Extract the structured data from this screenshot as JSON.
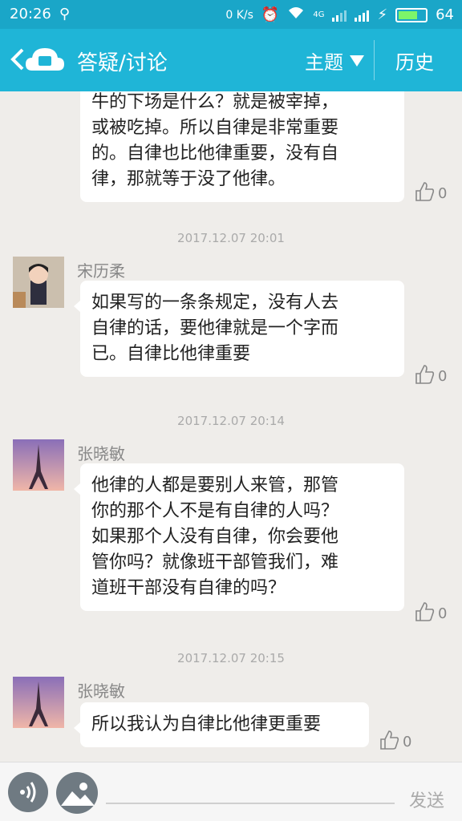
{
  "status": {
    "time": "20:26",
    "speed": "0 K/s",
    "network": "4G",
    "battery": "64",
    "battery_level": 0.64
  },
  "app": {
    "title": "答疑/讨论",
    "topic_label": "主题",
    "history_label": "历史"
  },
  "messages": [
    {
      "lines": [
        "牛的下场是什么？就是被宰掉，",
        "或被吃掉。所以自律是非常重要",
        "的。自律也比他律重要，没有自",
        "律，那就等于没了他律。"
      ],
      "likes": "0"
    },
    {
      "timestamp": "2017.12.07 20:01",
      "author": "宋历柔",
      "lines": [
        "如果写的一条条规定，没有人去",
        "自律的话，要他律就是一个字而",
        "已。自律比他律重要"
      ],
      "likes": "0"
    },
    {
      "timestamp": "2017.12.07 20:14",
      "author": "张晓敏",
      "lines": [
        "他律的人都是要别人来管，那管",
        "你的那个人不是有自律的人吗？",
        "如果那个人没有自律，你会要他",
        "管你吗？就像班干部管我们，难",
        "道班干部没有自律的吗？"
      ],
      "likes": "0"
    },
    {
      "timestamp": "2017.12.07 20:15",
      "author": "张晓敏",
      "lines": [
        "所以我认为自律比他律更重要"
      ],
      "likes": "0"
    }
  ],
  "input": {
    "send_label": "发送"
  }
}
